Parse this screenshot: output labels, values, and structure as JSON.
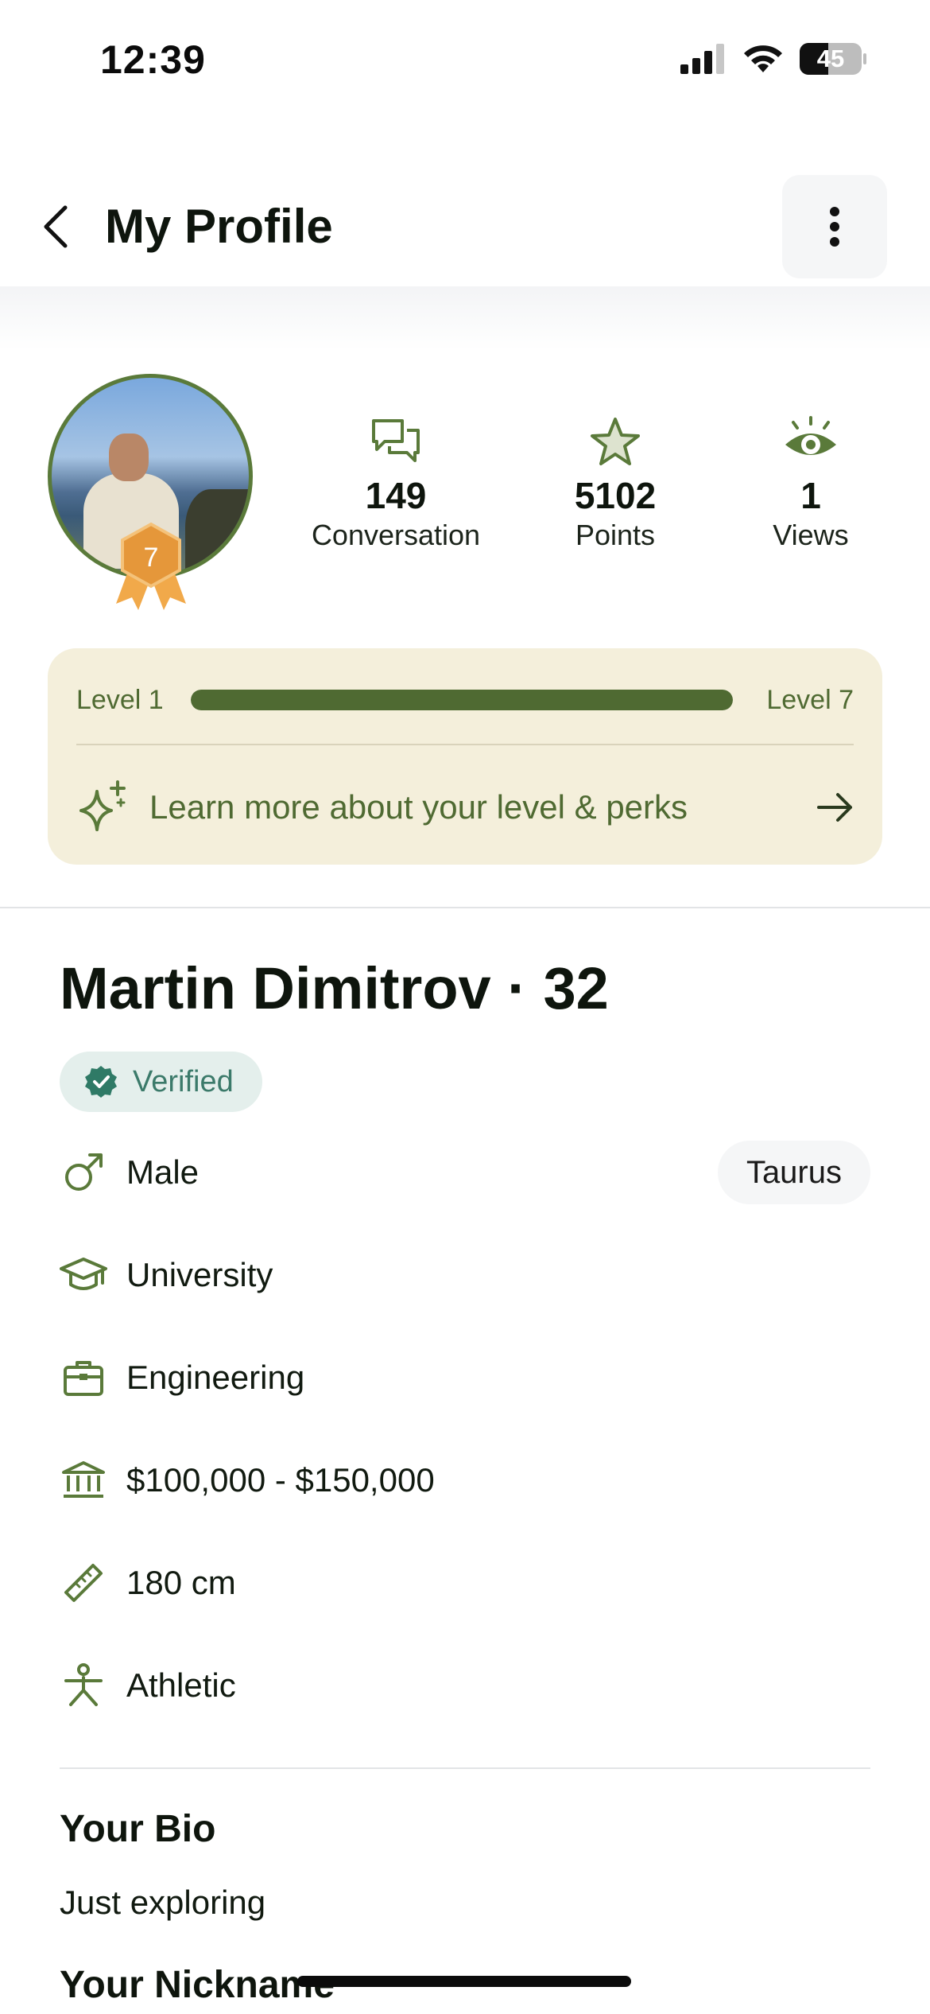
{
  "status_bar": {
    "time": "12:39",
    "battery": "45"
  },
  "header": {
    "title": "My Profile"
  },
  "stats": [
    {
      "icon": "chat-bubbles-icon",
      "value": "149",
      "label": "Conversation"
    },
    {
      "icon": "star-icon",
      "value": "5102",
      "label": "Points"
    },
    {
      "icon": "eye-icon",
      "value": "1",
      "label": "Views"
    }
  ],
  "avatar": {
    "level_badge": "7"
  },
  "level_card": {
    "start_label": "Level 1",
    "end_label": "Level 7",
    "progress": 1.0,
    "link_text": "Learn more about your level & perks"
  },
  "profile": {
    "name_line": "Martin Dimitrov · 32",
    "verified_label": "Verified",
    "zodiac": "Taurus",
    "details": [
      {
        "icon": "male-gender-icon",
        "text": "Male"
      },
      {
        "icon": "graduation-cap-icon",
        "text": "University"
      },
      {
        "icon": "briefcase-icon",
        "text": "Engineering"
      },
      {
        "icon": "bank-icon",
        "text": "$100,000 - $150,000"
      },
      {
        "icon": "ruler-icon",
        "text": "180 cm"
      },
      {
        "icon": "body-figure-icon",
        "text": "Athletic"
      }
    ]
  },
  "bio": {
    "title": "Your Bio",
    "text": "Just exploring"
  },
  "nickname": {
    "title": "Your Nickname"
  },
  "colors": {
    "accent": "#4f6a32",
    "card_bg": "#f4efdb",
    "verified": "#3b7a6a"
  }
}
